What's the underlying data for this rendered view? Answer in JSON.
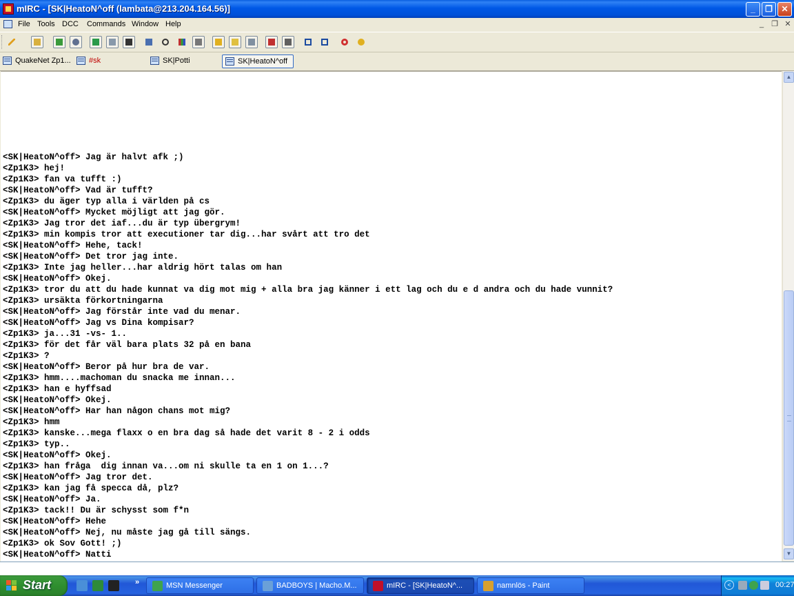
{
  "window": {
    "title": "mIRC - [SK|HeatoN^off (lambata@213.204.164.56)]",
    "minimize_glyph": "_",
    "maximize_glyph": "❐",
    "close_glyph": "✕"
  },
  "menu": {
    "items": [
      "File",
      "Tools",
      "DCC",
      "Commands",
      "Window",
      "Help"
    ],
    "mdi_minimize": "_",
    "mdi_restore": "❐",
    "mdi_close": "✕"
  },
  "toolbar": {
    "icons": [
      "connect-icon",
      "options-icon",
      "channels-icon",
      "scripts-icon",
      "address-book-icon",
      "urls-icon",
      "notify-icon",
      "dcc-chat-icon",
      "timer-icon",
      "colors-icon",
      "logs-icon",
      "received-icon",
      "notes-icon",
      "finger-icon",
      "perform-icon",
      "tile-icon",
      "cascade-icon",
      "arrange-icon",
      "help-icon",
      "about-icon"
    ]
  },
  "switchbar": {
    "tabs": [
      {
        "label": "QuakeNet Zp1..."
      },
      {
        "label": "#sk"
      },
      {
        "label": "SK|Potti"
      },
      {
        "label": "SK|HeatoN^off"
      }
    ]
  },
  "chat": {
    "lines": [
      "<SK|HeatoN^off> Jag är halvt afk ;)",
      "<Zp1K3> hej!",
      "<Zp1K3> fan va tufft :)",
      "<SK|HeatoN^off> Vad är tufft?",
      "<Zp1K3> du äger typ alla i världen på cs",
      "<SK|HeatoN^off> Mycket möjligt att jag gör.",
      "<Zp1K3> Jag tror det iaf...du är typ übergrym!",
      "<Zp1K3> min kompis tror att executioner tar dig...har svårt att tro det",
      "<SK|HeatoN^off> Hehe, tack!",
      "<SK|HeatoN^off> Det tror jag inte.",
      "<Zp1K3> Inte jag heller...har aldrig hört talas om han",
      "<SK|HeatoN^off> Okej.",
      "<Zp1K3> tror du att du hade kunnat va dig mot mig + alla bra jag känner i ett lag och du e d andra och du hade vunnit?",
      "<Zp1K3> ursäkta förkortningarna",
      "<SK|HeatoN^off> Jag förstår inte vad du menar.",
      "<SK|HeatoN^off> Jag vs Dina kompisar?",
      "<Zp1K3> ja...31 -vs- 1..",
      "<Zp1K3> för det får väl bara plats 32 på en bana",
      "<Zp1K3> ?",
      "<SK|HeatoN^off> Beror på hur bra de var.",
      "<Zp1K3> hmm....machoman du snacka me innan...",
      "<Zp1K3> han e hyffsad",
      "<SK|HeatoN^off> Okej.",
      "<SK|HeatoN^off> Har han någon chans mot mig?",
      "<Zp1K3> hmm",
      "<Zp1K3> kanske...mega flaxx o en bra dag så hade det varit 8 - 2 i odds",
      "<Zp1K3> typ..",
      "<SK|HeatoN^off> Okej.",
      "<Zp1K3> han fråga  dig innan va...om ni skulle ta en 1 on 1...?",
      "<SK|HeatoN^off> Jag tror det.",
      "<Zp1K3> kan jag få specca då, plz?",
      "<SK|HeatoN^off> Ja.",
      "<Zp1K3> tack!! Du är schysst som f*n",
      "<SK|HeatoN^off> Hehe",
      "<SK|HeatoN^off> Nej, nu måste jag gå till sängs.",
      "<Zp1K3> ok Sov Gott! ;)",
      "<SK|HeatoN^off> Natti"
    ]
  },
  "editbox": {
    "value": ""
  },
  "scrollbar": {
    "up_glyph": "▲",
    "down_glyph": "▼",
    "position_fraction": 0.95
  },
  "taskbar": {
    "start_label": "Start",
    "quicklaunch_more": "»",
    "tasks": [
      {
        "label": "MSN Messenger"
      },
      {
        "label": "BADBOYS | Macho.M..."
      },
      {
        "label": "mIRC - [SK|HeatoN^..."
      },
      {
        "label": "namnlös - Paint"
      }
    ],
    "tray_arrow": "<",
    "clock": "00:27"
  }
}
